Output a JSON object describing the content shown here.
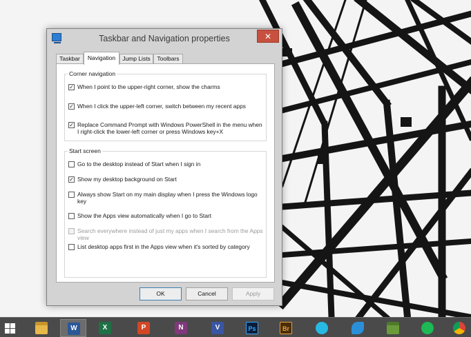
{
  "window": {
    "title": "Taskbar and Navigation properties",
    "close_glyph": "✕"
  },
  "tabs": [
    {
      "label": "Taskbar",
      "active": false
    },
    {
      "label": "Navigation",
      "active": true
    },
    {
      "label": "Jump Lists",
      "active": false
    },
    {
      "label": "Toolbars",
      "active": false
    }
  ],
  "corner_navigation": {
    "label": "Corner navigation",
    "options": [
      {
        "text": "When I point to the upper-right corner, show the charms",
        "checked": true,
        "enabled": true
      },
      {
        "text": "When I click the upper-left corner, switch between my recent apps",
        "checked": true,
        "enabled": true
      },
      {
        "text": "Replace Command Prompt with Windows PowerShell in the menu when I right-click the lower-left corner or press Windows key+X",
        "checked": true,
        "enabled": true
      }
    ]
  },
  "start_screen": {
    "label": "Start screen",
    "options": [
      {
        "text": "Go to the desktop instead of Start when I sign in",
        "checked": false,
        "enabled": true
      },
      {
        "text": "Show my desktop background on Start",
        "checked": true,
        "enabled": true
      },
      {
        "text": "Always show Start on my main display when I press the Windows logo key",
        "checked": false,
        "enabled": true
      },
      {
        "text": "Show the Apps view automatically when I go to Start",
        "checked": false,
        "enabled": true
      },
      {
        "text": "Search everywhere instead of just my apps when I search from the Apps view",
        "checked": false,
        "enabled": false
      },
      {
        "text": "List desktop apps first in the Apps view when it's sorted by category",
        "checked": false,
        "enabled": true
      }
    ]
  },
  "buttons": {
    "ok": "OK",
    "cancel": "Cancel",
    "apply": "Apply"
  },
  "taskbar": {
    "items": [
      {
        "name": "start-button",
        "icon": "windows-logo-icon",
        "glyph": "",
        "color": "#4a4a4a",
        "active": false
      },
      {
        "name": "taskbar-file-explorer",
        "icon": "file-explorer-icon",
        "glyph": "",
        "color": "#e8b84a",
        "active": false
      },
      {
        "name": "taskbar-word",
        "icon": "word-icon",
        "glyph": "W",
        "color": "#2b5797",
        "active": true
      },
      {
        "name": "taskbar-excel",
        "icon": "excel-icon",
        "glyph": "X",
        "color": "#1e7145",
        "active": false
      },
      {
        "name": "taskbar-powerpoint",
        "icon": "powerpoint-icon",
        "glyph": "P",
        "color": "#d24726",
        "active": false
      },
      {
        "name": "taskbar-onenote",
        "icon": "onenote-icon",
        "glyph": "N",
        "color": "#80397b",
        "active": false
      },
      {
        "name": "taskbar-visio",
        "icon": "visio-icon",
        "glyph": "V",
        "color": "#3955a3",
        "active": false
      },
      {
        "name": "taskbar-photoshop",
        "icon": "photoshop-icon",
        "glyph": "Ps",
        "color": "#0a1d3a",
        "active": false
      },
      {
        "name": "taskbar-bridge",
        "icon": "bridge-icon",
        "glyph": "Br",
        "color": "#4a2c0a",
        "active": false
      },
      {
        "name": "taskbar-disc-app",
        "icon": "disc-icon",
        "glyph": "",
        "color": "#27b9e4",
        "active": false
      },
      {
        "name": "taskbar-browser-app",
        "icon": "wave-icon",
        "glyph": "",
        "color": "#2a8fd8",
        "active": false
      },
      {
        "name": "taskbar-minecraft",
        "icon": "minecraft-icon",
        "glyph": "",
        "color": "#6a9a3a",
        "active": false
      },
      {
        "name": "taskbar-spotify",
        "icon": "spotify-icon",
        "glyph": "",
        "color": "#1db954",
        "active": false
      },
      {
        "name": "taskbar-chrome",
        "icon": "chrome-icon",
        "glyph": "",
        "color": "#db4437",
        "active": false
      }
    ]
  },
  "colors": {
    "dialog_bg": "#d3d3d3",
    "close_button": "#c7503f",
    "taskbar_bg": "#4a4a4a"
  }
}
